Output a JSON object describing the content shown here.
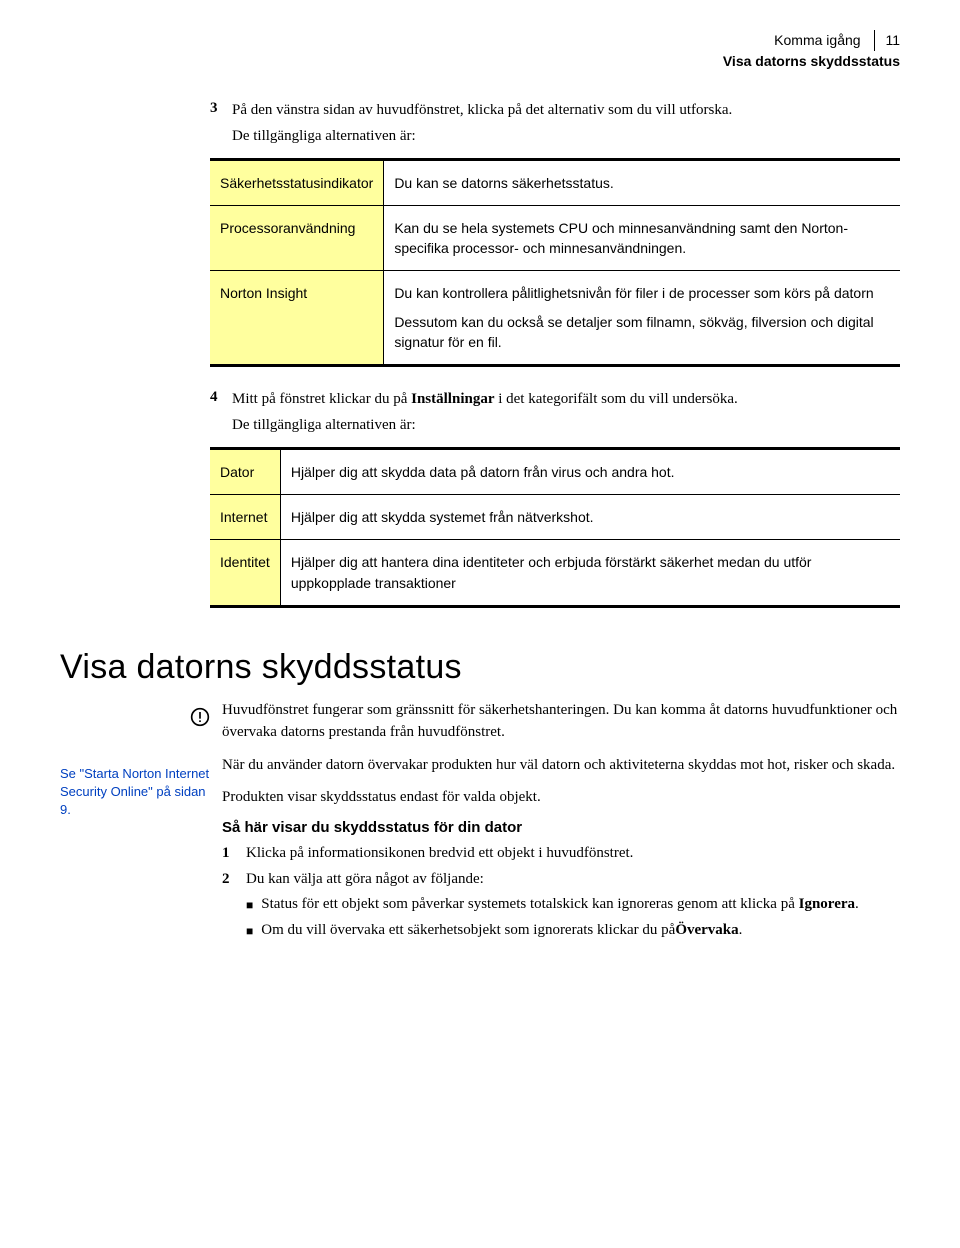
{
  "header": {
    "line1": "Komma igång",
    "line2": "Visa datorns skyddsstatus",
    "page_number": "11"
  },
  "step3": {
    "num": "3",
    "text_a": "På den vänstra sidan av huvudfönstret, klicka på det alternativ som du vill utforska.",
    "text_b": "De tillgängliga alternativen är:"
  },
  "table1": [
    {
      "label": "Säkerhetsstatusindikator",
      "desc": [
        "Du kan se datorns säkerhetsstatus."
      ]
    },
    {
      "label": "Processoranvändning",
      "desc": [
        "Kan du se hela systemets CPU och minnesanvändning samt den Norton-specifika processor- och minnesanvändningen."
      ]
    },
    {
      "label": "Norton Insight",
      "desc": [
        "Du kan kontrollera pålitlighetsnivån för filer i de processer som körs på datorn",
        "Dessutom kan du också se detaljer som filnamn, sökväg, filversion och digital signatur för en fil."
      ]
    }
  ],
  "step4": {
    "num": "4",
    "text_a": "Mitt på fönstret klickar du på ",
    "bold1": "Inställningar",
    "text_b": " i det kategorifält som du vill undersöka.",
    "text_c": "De tillgängliga alternativen är:"
  },
  "table2": [
    {
      "label": "Dator",
      "desc": [
        "Hjälper dig att skydda data på datorn från virus och andra hot."
      ]
    },
    {
      "label": "Internet",
      "desc": [
        "Hjälper dig att skydda systemet från nätverkshot."
      ]
    },
    {
      "label": "Identitet",
      "desc": [
        "Hjälper dig att hantera dina identiteter och erbjuda förstärkt säkerhet medan du utför uppkopplade transaktioner"
      ]
    }
  ],
  "section": {
    "heading": "Visa datorns skyddsstatus",
    "p1": "Huvudfönstret fungerar som gränssnitt för säkerhetshanteringen. Du kan komma åt datorns huvudfunktioner och övervaka datorns prestanda från huvudfönstret.",
    "p2": "När du använder datorn övervakar produkten hur väl datorn och aktiviteterna skyddas mot hot, risker och skada.",
    "p3": "Produkten visar skyddsstatus endast för valda objekt.",
    "subhead": "Så här visar du skyddsstatus för din dator",
    "list": {
      "item1": {
        "n": "1",
        "text": "Klicka på informationsikonen bredvid ett objekt i huvudfönstret."
      },
      "item2": {
        "n": "2",
        "text": "Du kan välja att göra något av följande:",
        "b1_a": "Status för ett objekt som påverkar systemets totalskick kan ignoreras genom att klicka på ",
        "b1_bold": "Ignorera",
        "b1_b": ".",
        "b2_a": "Om du vill övervaka ett säkerhetsobjekt som ignorerats klickar du på",
        "b2_bold": "Övervaka",
        "b2_b": "."
      }
    }
  },
  "sidebar_link": {
    "pre": "Se ",
    "link": "\"Starta Norton Internet Security Online\"",
    "post": " på sidan 9."
  }
}
